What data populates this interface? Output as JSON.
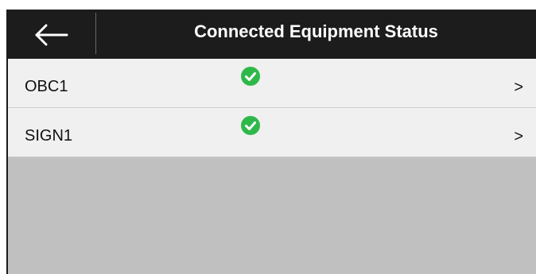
{
  "header": {
    "title": "Connected Equipment Status",
    "back_icon": "arrow-left-icon"
  },
  "equipment": [
    {
      "name": "OBC1",
      "status": "connected",
      "status_icon": "check-circle-icon",
      "chevron": ">"
    },
    {
      "name": "SIGN1",
      "status": "connected",
      "status_icon": "check-circle-icon",
      "chevron": ">"
    }
  ],
  "colors": {
    "header_bg": "#1c1c1c",
    "row_bg": "#f0f0f0",
    "empty_area_bg": "#c0c0c0",
    "status_ok": "#2fb84a"
  }
}
